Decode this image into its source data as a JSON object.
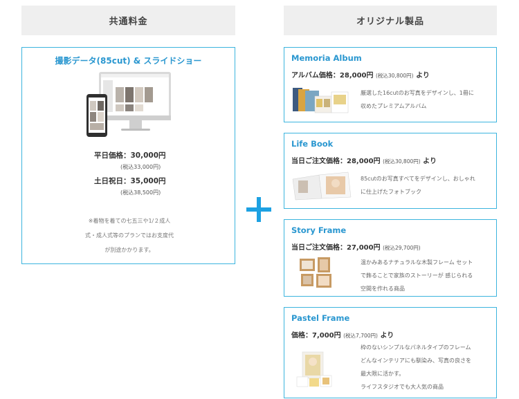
{
  "headers": {
    "left": "共通料金",
    "right": "オリジナル製品"
  },
  "common": {
    "title": "撮影データ(85cut) & スライドショー",
    "weekday_label": "平日価格：30,000円",
    "weekday_tax": "(税込33,000円)",
    "holiday_label": "土日祝日：35,000円",
    "holiday_tax": "(税込38,500円)",
    "note": "※着物を着ての七五三や1/２成人\n式・成人式等のプランではお支度代\nが別途かかります。"
  },
  "products": [
    {
      "name": "Memoria Album",
      "price": "アルバム価格：28,000円",
      "tax": "(税込30,800円)",
      "suffix": "より",
      "description": "厳選した16cutのお写真をデザインし、1冊に\n収めたプレミアムアルバム"
    },
    {
      "name": "Life Book",
      "price": "当日ご注文価格：28,000円",
      "tax": "(税込30,800円)",
      "suffix": "より",
      "description": "85cutのお写真すべてをデザインし、おしゃれ\nに仕上げたフォトブック"
    },
    {
      "name": "Story Frame",
      "price": "当日ご注文価格：27,000円",
      "tax": "(税込29,700円)",
      "suffix": "",
      "description": "温かみあるナチュラルな木製フレーム セット\nで飾ることで家族のストーリーが 感じられる\n空間を作れる商品"
    },
    {
      "name": "Pastel Frame",
      "price": "価格：7,000円",
      "tax": "(税込7,700円)",
      "suffix": "より",
      "description": "枠のないシンプルなパネルタイプのフレーム\nどんなインテリアにも馴染み、写真の良さを\n最大限に活かす。\nライフスタジオでも大人気の商品"
    }
  ],
  "colors": {
    "accent": "#2a97d0",
    "border": "#3bb4de",
    "plus": "#1da1e2",
    "header_bg": "#efefef"
  },
  "icons": {
    "plus": "plus-icon"
  }
}
